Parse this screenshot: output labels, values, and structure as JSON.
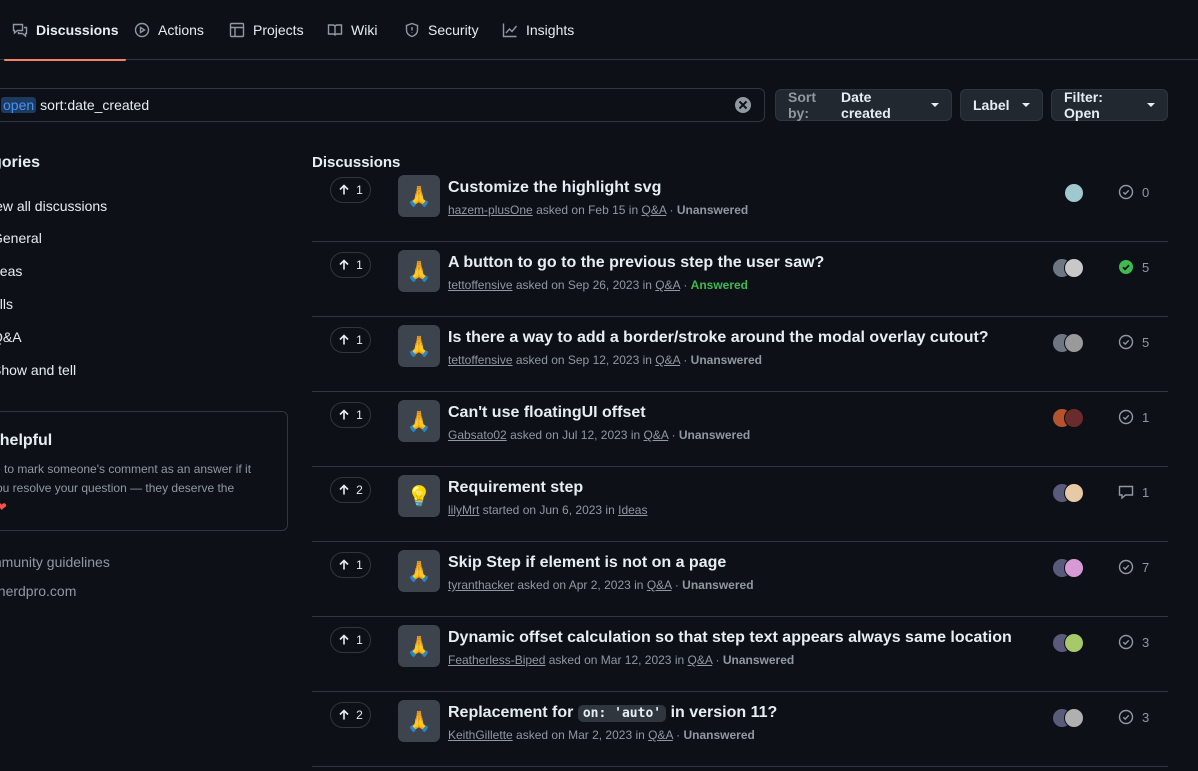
{
  "nav": {
    "tabs": [
      {
        "label": "Discussions",
        "icon": "comment-discussion-icon"
      },
      {
        "label": "Actions",
        "icon": "play-icon"
      },
      {
        "label": "Projects",
        "icon": "table-icon"
      },
      {
        "label": "Wiki",
        "icon": "book-icon"
      },
      {
        "label": "Security",
        "icon": "shield-icon"
      },
      {
        "label": "Insights",
        "icon": "graph-icon"
      }
    ]
  },
  "search": {
    "open_token": "open",
    "query": "sort:date_created"
  },
  "toolbar": {
    "sort_prefix": "Sort by:",
    "sort_value": "Date created",
    "label_button": "Label",
    "filter_button": "Filter: Open"
  },
  "sidebar": {
    "title": "gories",
    "categories": [
      "iew all discussions",
      "General",
      "deas",
      "olls",
      "Q&A",
      "Show and tell"
    ],
    "help": {
      "title": "t helpful",
      "line1": "re to mark someone's comment as an answer if it",
      "line2": "you resolve your question — they deserve the",
      "line3": "!",
      "heart": "❤"
    },
    "links": [
      "mmunity guidelines",
      "pherdpro.com"
    ]
  },
  "discussions": {
    "heading": "Discussions",
    "items": [
      {
        "votes": "1",
        "icon": "🙏",
        "title": "Customize the highlight svg",
        "author": "hazem-plusOne",
        "verb": "asked on Feb 15 in",
        "category": "Q&A",
        "status": "Unanswered",
        "comments": "0",
        "answered": false,
        "avatars": [
          "#9fc9cf"
        ]
      },
      {
        "votes": "1",
        "icon": "🙏",
        "title": "A button to go to the previous step the user saw?",
        "author": "tettoffensive",
        "verb": "asked on Sep 26, 2023 in",
        "category": "Q&A",
        "status": "Answered",
        "comments": "5",
        "answered": true,
        "avatars": [
          "#6e7681",
          "#c8c8c8"
        ]
      },
      {
        "votes": "1",
        "icon": "🙏",
        "title": "Is there a way to add a border/stroke around the modal overlay cutout?",
        "author": "tettoffensive",
        "verb": "asked on Sep 12, 2023 in",
        "category": "Q&A",
        "status": "Unanswered",
        "comments": "5",
        "answered": false,
        "avatars": [
          "#6e7681",
          "#9a9a9a"
        ]
      },
      {
        "votes": "1",
        "icon": "🙏",
        "title": "Can't use floatingUI offset",
        "author": "Gabsato02",
        "verb": "asked on Jul 12, 2023 in",
        "category": "Q&A",
        "status": "Unanswered",
        "comments": "1",
        "answered": false,
        "avatars": [
          "#b5532f",
          "#6a2b2b"
        ]
      },
      {
        "votes": "2",
        "icon": "💡",
        "title": "Requirement step",
        "author": "lilyMrt",
        "verb": "started on Jun 6, 2023 in",
        "category": "Ideas",
        "status": "",
        "comments": "1",
        "answered": false,
        "avatars": [
          "#5a5a7a",
          "#e8c9a6"
        ]
      },
      {
        "votes": "1",
        "icon": "🙏",
        "title": "Skip Step if element is not on a page",
        "author": "tyranthacker",
        "verb": "asked on Apr 2, 2023 in",
        "category": "Q&A",
        "status": "Unanswered",
        "comments": "7",
        "answered": false,
        "avatars": [
          "#5a5a7a",
          "#d89ad6"
        ]
      },
      {
        "votes": "1",
        "icon": "🙏",
        "title": "Dynamic offset calculation so that step text appears always same location",
        "author": "Featherless-Biped",
        "verb": "asked on Mar 12, 2023 in",
        "category": "Q&A",
        "status": "Unanswered",
        "comments": "3",
        "answered": false,
        "avatars": [
          "#5a5a7a",
          "#a6c96a"
        ]
      },
      {
        "votes": "2",
        "icon": "🙏",
        "title_before": "Replacement for",
        "title_code": "on: 'auto'",
        "title_after": "in version 11?",
        "author": "KeithGillette",
        "verb": "asked on Mar 2, 2023 in",
        "category": "Q&A",
        "status": "Unanswered",
        "comments": "3",
        "answered": false,
        "avatars": [
          "#5a5a7a",
          "#b0b0b0"
        ]
      }
    ]
  }
}
